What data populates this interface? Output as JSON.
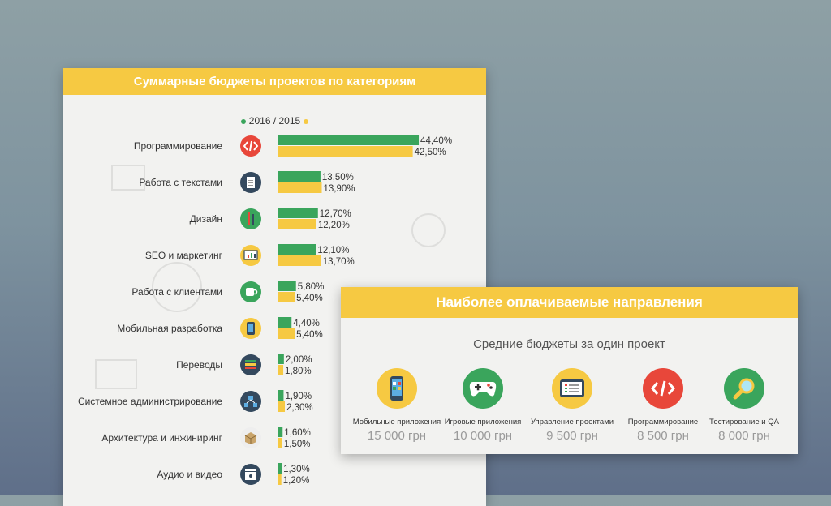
{
  "left_card": {
    "title": "Суммарные бюджеты проектов по категориям"
  },
  "right_card": {
    "title": "Наиболее оплачиваемые направления",
    "subtitle": "Средние бюджеты за один проект",
    "items": [
      {
        "name": "Мобильные приложения",
        "price": "15 000 грн",
        "icon": "mobile-app-icon",
        "color": "#f6c942"
      },
      {
        "name": "Игровые приложения",
        "price": "10 000 грн",
        "icon": "gamepad-icon",
        "color": "#3aa55c"
      },
      {
        "name": "Управление проектами",
        "price": "9 500 грн",
        "icon": "tablet-checklist-icon",
        "color": "#f6c942"
      },
      {
        "name": "Программирование",
        "price": "8 500 грн",
        "icon": "code-icon",
        "color": "#e8473a"
      },
      {
        "name": "Тестирование и QA",
        "price": "8 000 грн",
        "icon": "magnifier-icon",
        "color": "#3aa55c"
      }
    ]
  },
  "chart_data": {
    "type": "bar",
    "orientation": "horizontal",
    "title": "Суммарные бюджеты проектов по категориям",
    "legend_label": "2016 / 2015",
    "legend_placement": "top",
    "categories": [
      "Программирование",
      "Работа с текстами",
      "Дизайн",
      "SEO и маркетинг",
      "Работа с клиентами",
      "Мобильная разработка",
      "Переводы",
      "Системное администрирование",
      "Архитектура и инжиниринг",
      "Аудио и видео"
    ],
    "category_icons": [
      "code-icon",
      "document-icon",
      "pencils-icon",
      "presentation-icon",
      "cup-icon",
      "mobile-icon",
      "books-icon",
      "network-icon",
      "box-icon",
      "clapperboard-icon"
    ],
    "category_icon_colors": [
      "#e8473a",
      "#34495e",
      "#3aa55c",
      "#f6c942",
      "#3aa55c",
      "#f6c942",
      "#34495e",
      "#34495e",
      "#eeeeee",
      "#34495e"
    ],
    "series": [
      {
        "name": "2016",
        "color": "#3aa55c",
        "values": [
          44.4,
          13.5,
          12.7,
          12.1,
          5.8,
          4.4,
          2.0,
          1.9,
          1.6,
          1.3
        ],
        "labels": [
          "44,40%",
          "13,50%",
          "12,70%",
          "12,10%",
          "5,80%",
          "4,40%",
          "2,00%",
          "1,90%",
          "1,60%",
          "1,30%"
        ]
      },
      {
        "name": "2015",
        "color": "#f6c942",
        "values": [
          42.5,
          13.9,
          12.2,
          13.7,
          5.4,
          5.4,
          1.8,
          2.3,
          1.5,
          1.2
        ],
        "labels": [
          "42,50%",
          "13,90%",
          "12,20%",
          "13,70%",
          "5,40%",
          "5,40%",
          "1,80%",
          "2,30%",
          "1,50%",
          "1,20%"
        ]
      }
    ],
    "unit": "%",
    "grid": false,
    "axes_visible": false
  }
}
